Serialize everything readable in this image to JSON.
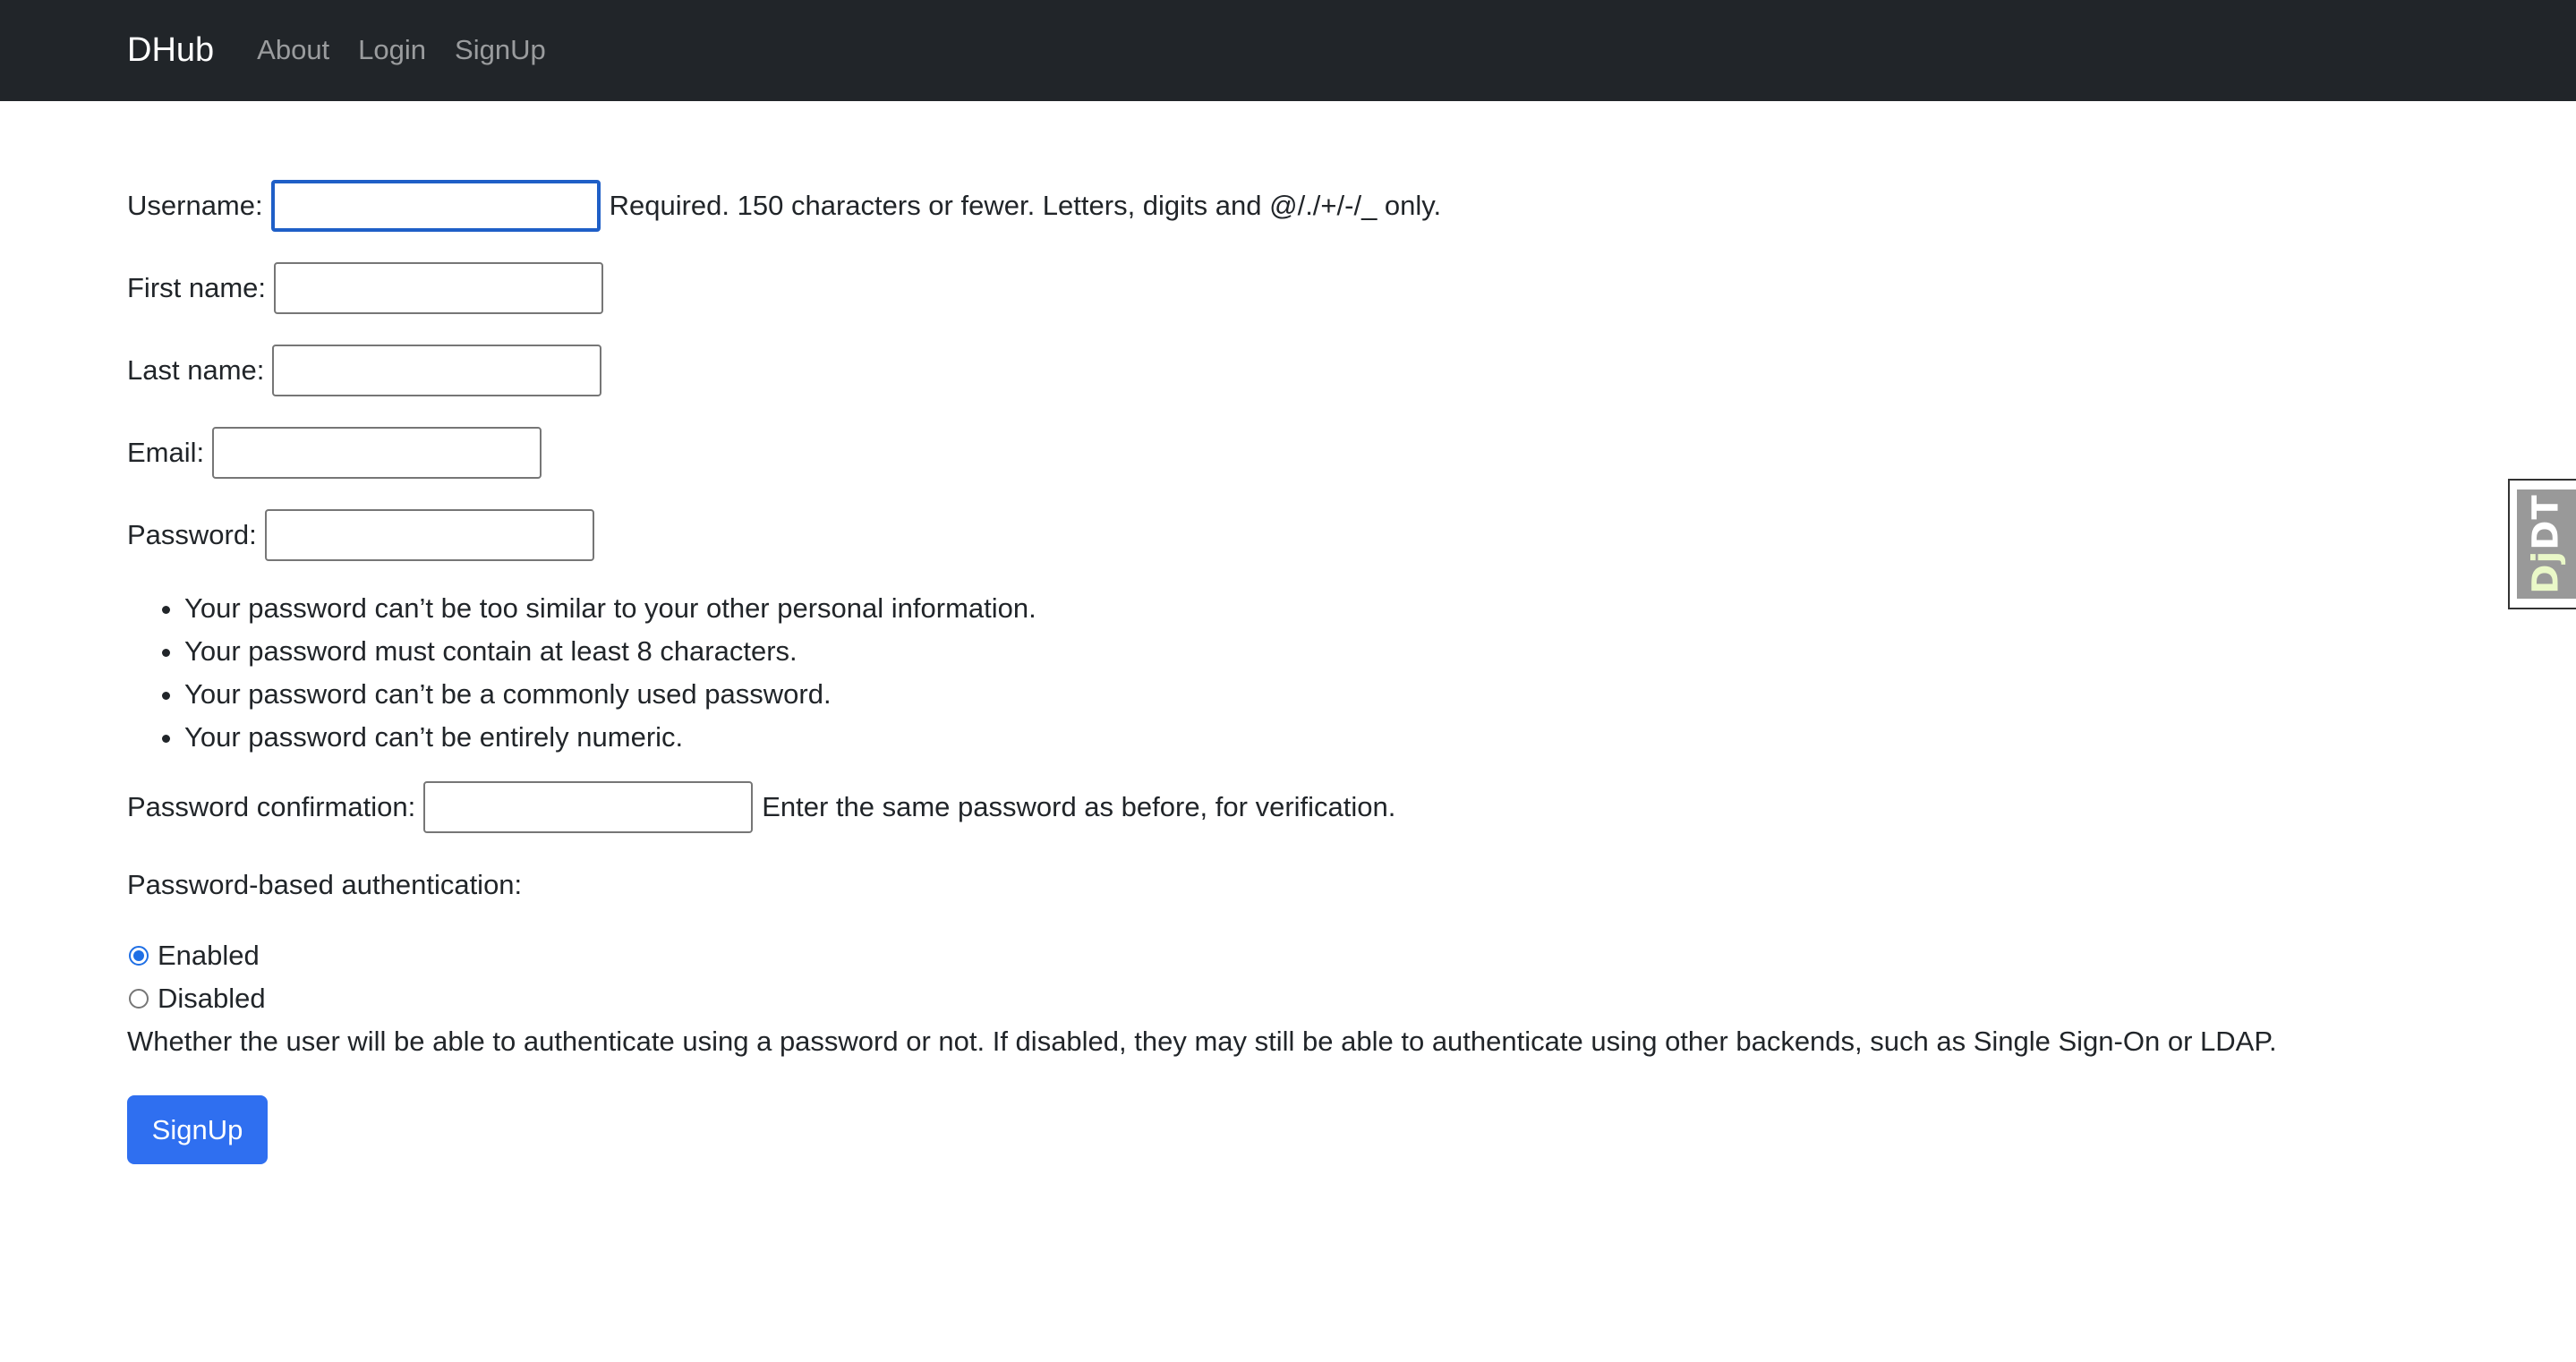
{
  "navbar": {
    "brand": "DHub",
    "links": [
      "About",
      "Login",
      "SignUp"
    ]
  },
  "form": {
    "username": {
      "label": "Username:",
      "value": "",
      "help": "Required. 150 characters or fewer. Letters, digits and @/./+/-/_ only."
    },
    "first_name": {
      "label": "First name:",
      "value": ""
    },
    "last_name": {
      "label": "Last name:",
      "value": ""
    },
    "email": {
      "label": "Email:",
      "value": ""
    },
    "password": {
      "label": "Password:",
      "value": ""
    },
    "password_rules": [
      "Your password can’t be too similar to your other personal information.",
      "Your password must contain at least 8 characters.",
      "Your password can’t be a commonly used password.",
      "Your password can’t be entirely numeric."
    ],
    "password_confirmation": {
      "label": "Password confirmation:",
      "value": "",
      "help": "Enter the same password as before, for verification."
    },
    "auth": {
      "label": "Password-based authentication:",
      "options": [
        {
          "label": "Enabled",
          "checked": true
        },
        {
          "label": "Disabled",
          "checked": false
        }
      ],
      "help": "Whether the user will be able to authenticate using a password or not. If disabled, they may still be able to authenticate using other backends, such as Single Sign-On or LDAP."
    },
    "submit_label": "SignUp"
  },
  "debug_toolbar": {
    "label_prefix": "Dj",
    "label_suffix": "DT"
  },
  "colors": {
    "navbar_bg": "#212529",
    "primary": "#2f6ff0",
    "focus_border": "#1f5fc7"
  }
}
